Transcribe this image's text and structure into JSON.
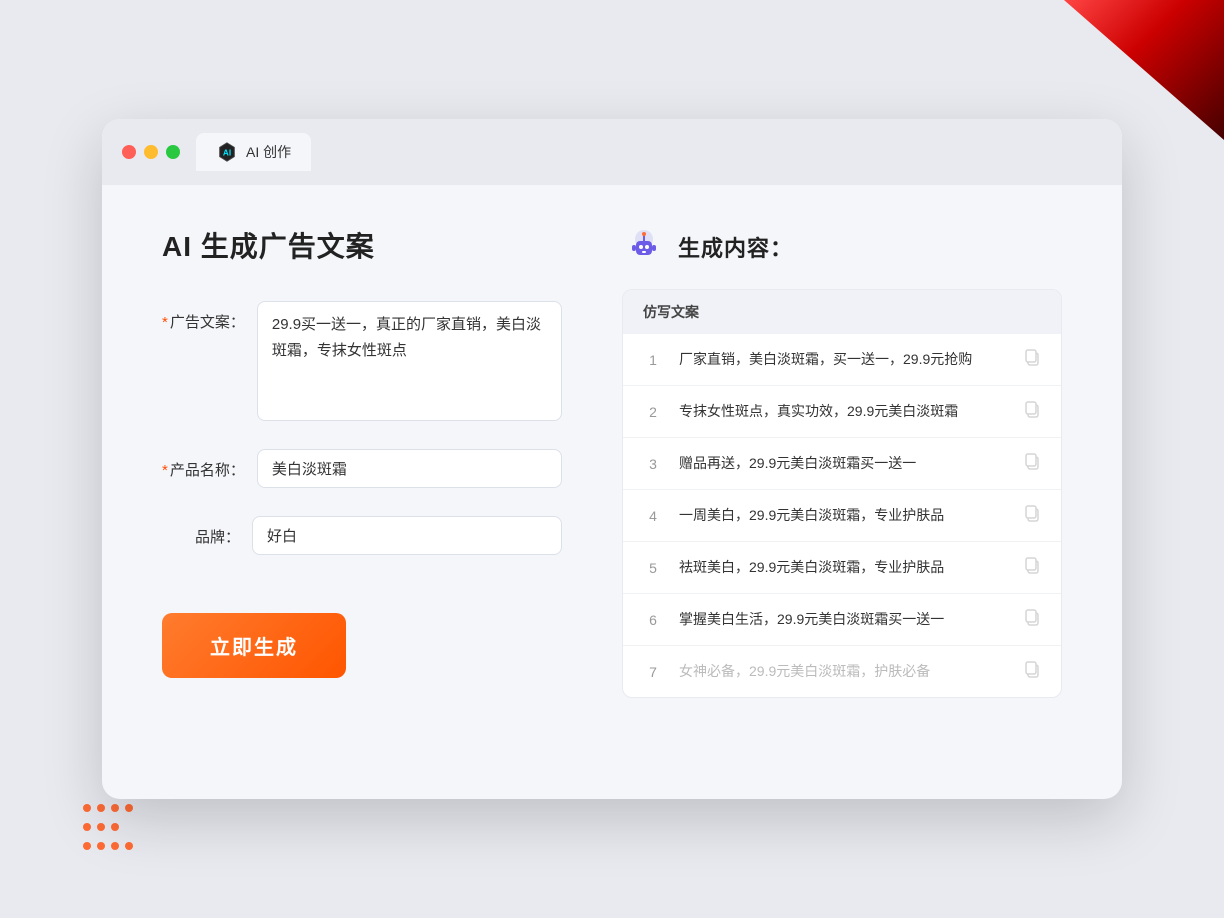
{
  "browser": {
    "tab_title": "AI 创作",
    "window_btn_close": "close",
    "window_btn_minimize": "minimize",
    "window_btn_maximize": "maximize"
  },
  "left_panel": {
    "page_title": "AI 生成广告文案",
    "form": {
      "ad_copy_label": "广告文案：",
      "ad_copy_required": "*",
      "ad_copy_value": "29.9买一送一，真正的厂家直销，美白淡斑霜，专抹女性斑点",
      "product_name_label": "产品名称：",
      "product_name_required": "*",
      "product_name_value": "美白淡斑霜",
      "brand_label": "品牌：",
      "brand_value": "好白"
    },
    "generate_button": "立即生成"
  },
  "right_panel": {
    "result_title": "生成内容：",
    "table_header": "仿写文案",
    "results": [
      {
        "num": "1",
        "text": "厂家直销，美白淡斑霜，买一送一，29.9元抢购",
        "dimmed": false
      },
      {
        "num": "2",
        "text": "专抹女性斑点，真实功效，29.9元美白淡斑霜",
        "dimmed": false
      },
      {
        "num": "3",
        "text": "赠品再送，29.9元美白淡斑霜买一送一",
        "dimmed": false
      },
      {
        "num": "4",
        "text": "一周美白，29.9元美白淡斑霜，专业护肤品",
        "dimmed": false
      },
      {
        "num": "5",
        "text": "祛斑美白，29.9元美白淡斑霜，专业护肤品",
        "dimmed": false
      },
      {
        "num": "6",
        "text": "掌握美白生活，29.9元美白淡斑霜买一送一",
        "dimmed": false
      },
      {
        "num": "7",
        "text": "女神必备，29.9元美白淡斑霜，护肤必备",
        "dimmed": true
      }
    ]
  }
}
